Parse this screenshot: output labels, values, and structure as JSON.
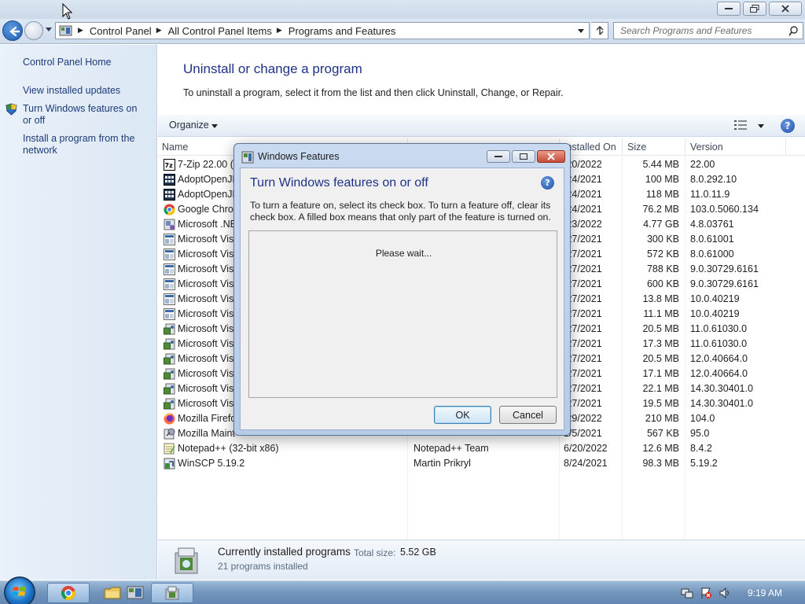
{
  "address": {
    "crumbs": [
      "Control Panel",
      "All Control Panel Items",
      "Programs and Features"
    ],
    "search_placeholder": "Search Programs and Features"
  },
  "sidebar": {
    "home": "Control Panel Home",
    "items": [
      {
        "label": "View installed updates"
      },
      {
        "label": "Turn Windows features on or off"
      },
      {
        "label": "Install a program from the network"
      }
    ]
  },
  "main": {
    "title": "Uninstall or change a program",
    "description": "To uninstall a program, select it from the list and then click Uninstall, Change, or Repair."
  },
  "toolbar": {
    "organize": "Organize"
  },
  "columns": {
    "name": "Name",
    "installed_on": "Installed On",
    "size": "Size",
    "version": "Version"
  },
  "programs": [
    {
      "name": "7-Zip 22.00 (x",
      "publisher": "",
      "installed": "/20/2022",
      "size": "5.44 MB",
      "version": "22.00",
      "icon": "7zip-icon"
    },
    {
      "name": "AdoptOpenJD",
      "publisher": "",
      "installed": "/24/2021",
      "size": "100 MB",
      "version": "8.0.292.10",
      "icon": "java-icon"
    },
    {
      "name": "AdoptOpenJD",
      "publisher": "",
      "installed": "/24/2021",
      "size": "118 MB",
      "version": "11.0.11.9",
      "icon": "java-icon"
    },
    {
      "name": "Google Chror",
      "publisher": "",
      "installed": "/24/2021",
      "size": "76.2 MB",
      "version": "103.0.5060.134",
      "icon": "chrome-icon"
    },
    {
      "name": "Microsoft .NE",
      "publisher": "",
      "installed": "/23/2022",
      "size": "4.77 GB",
      "version": "4.8.03761",
      "icon": "dotnet-icon"
    },
    {
      "name": "Microsoft Visu",
      "publisher": "",
      "installed": "/27/2021",
      "size": "300 KB",
      "version": "8.0.61001",
      "icon": "msi-icon"
    },
    {
      "name": "Microsoft Visu",
      "publisher": "",
      "installed": "/27/2021",
      "size": "572 KB",
      "version": "8.0.61000",
      "icon": "msi-icon"
    },
    {
      "name": "Microsoft Visu",
      "publisher": "",
      "installed": "/27/2021",
      "size": "788 KB",
      "version": "9.0.30729.6161",
      "icon": "msi-icon"
    },
    {
      "name": "Microsoft Visu",
      "publisher": "",
      "installed": "/27/2021",
      "size": "600 KB",
      "version": "9.0.30729.6161",
      "icon": "msi-icon"
    },
    {
      "name": "Microsoft Visu",
      "publisher": "",
      "installed": "/27/2021",
      "size": "13.8 MB",
      "version": "10.0.40219",
      "icon": "msi-icon"
    },
    {
      "name": "Microsoft Visu",
      "publisher": "",
      "installed": "/27/2021",
      "size": "11.1 MB",
      "version": "10.0.40219",
      "icon": "msi-icon"
    },
    {
      "name": "Microsoft Visu",
      "publisher": "",
      "installed": "/27/2021",
      "size": "20.5 MB",
      "version": "11.0.61030.0",
      "icon": "installer-icon"
    },
    {
      "name": "Microsoft Visu",
      "publisher": "",
      "installed": "/27/2021",
      "size": "17.3 MB",
      "version": "11.0.61030.0",
      "icon": "installer-icon"
    },
    {
      "name": "Microsoft Visu",
      "publisher": "",
      "installed": "/27/2021",
      "size": "20.5 MB",
      "version": "12.0.40664.0",
      "icon": "installer-icon"
    },
    {
      "name": "Microsoft Visu",
      "publisher": "",
      "installed": "/27/2021",
      "size": "17.1 MB",
      "version": "12.0.40664.0",
      "icon": "installer-icon"
    },
    {
      "name": "Microsoft Visu",
      "publisher": "",
      "installed": "/27/2021",
      "size": "22.1 MB",
      "version": "14.30.30401.0",
      "icon": "installer-icon"
    },
    {
      "name": "Microsoft Visu",
      "publisher": "",
      "installed": "/27/2021",
      "size": "19.5 MB",
      "version": "14.30.30401.0",
      "icon": "installer-icon"
    },
    {
      "name": "Mozilla Firefo",
      "publisher": "",
      "installed": "/29/2022",
      "size": "210 MB",
      "version": "104.0",
      "icon": "firefox-icon"
    },
    {
      "name": "Mozilla Maint",
      "publisher": "",
      "installed": "1/5/2021",
      "size": "567 KB",
      "version": "95.0",
      "icon": "mozilla-maint-icon"
    },
    {
      "name": "Notepad++ (32-bit x86)",
      "publisher": "Notepad++ Team",
      "installed": "6/20/2022",
      "size": "12.6 MB",
      "version": "8.4.2",
      "icon": "notepadpp-icon"
    },
    {
      "name": "WinSCP 5.19.2",
      "publisher": "Martin Prikryl",
      "installed": "8/24/2021",
      "size": "98.3 MB",
      "version": "5.19.2",
      "icon": "winscp-icon"
    }
  ],
  "details": {
    "title": "Currently installed programs",
    "total_size_label": "Total size:",
    "total_size": "5.52 GB",
    "count": "21 programs installed"
  },
  "dialog": {
    "title": "Windows Features",
    "heading": "Turn Windows features on or off",
    "instructions": "To turn a feature on, select its check box. To turn a feature off, clear its check box. A filled box means that only part of the feature is turned on.",
    "status": "Please wait...",
    "ok": "OK",
    "cancel": "Cancel"
  },
  "taskbar": {
    "time": "9:19 AM"
  },
  "colors": {
    "link": "#1d3b78",
    "title": "#1e3287",
    "taskbar": "#7394bb"
  }
}
